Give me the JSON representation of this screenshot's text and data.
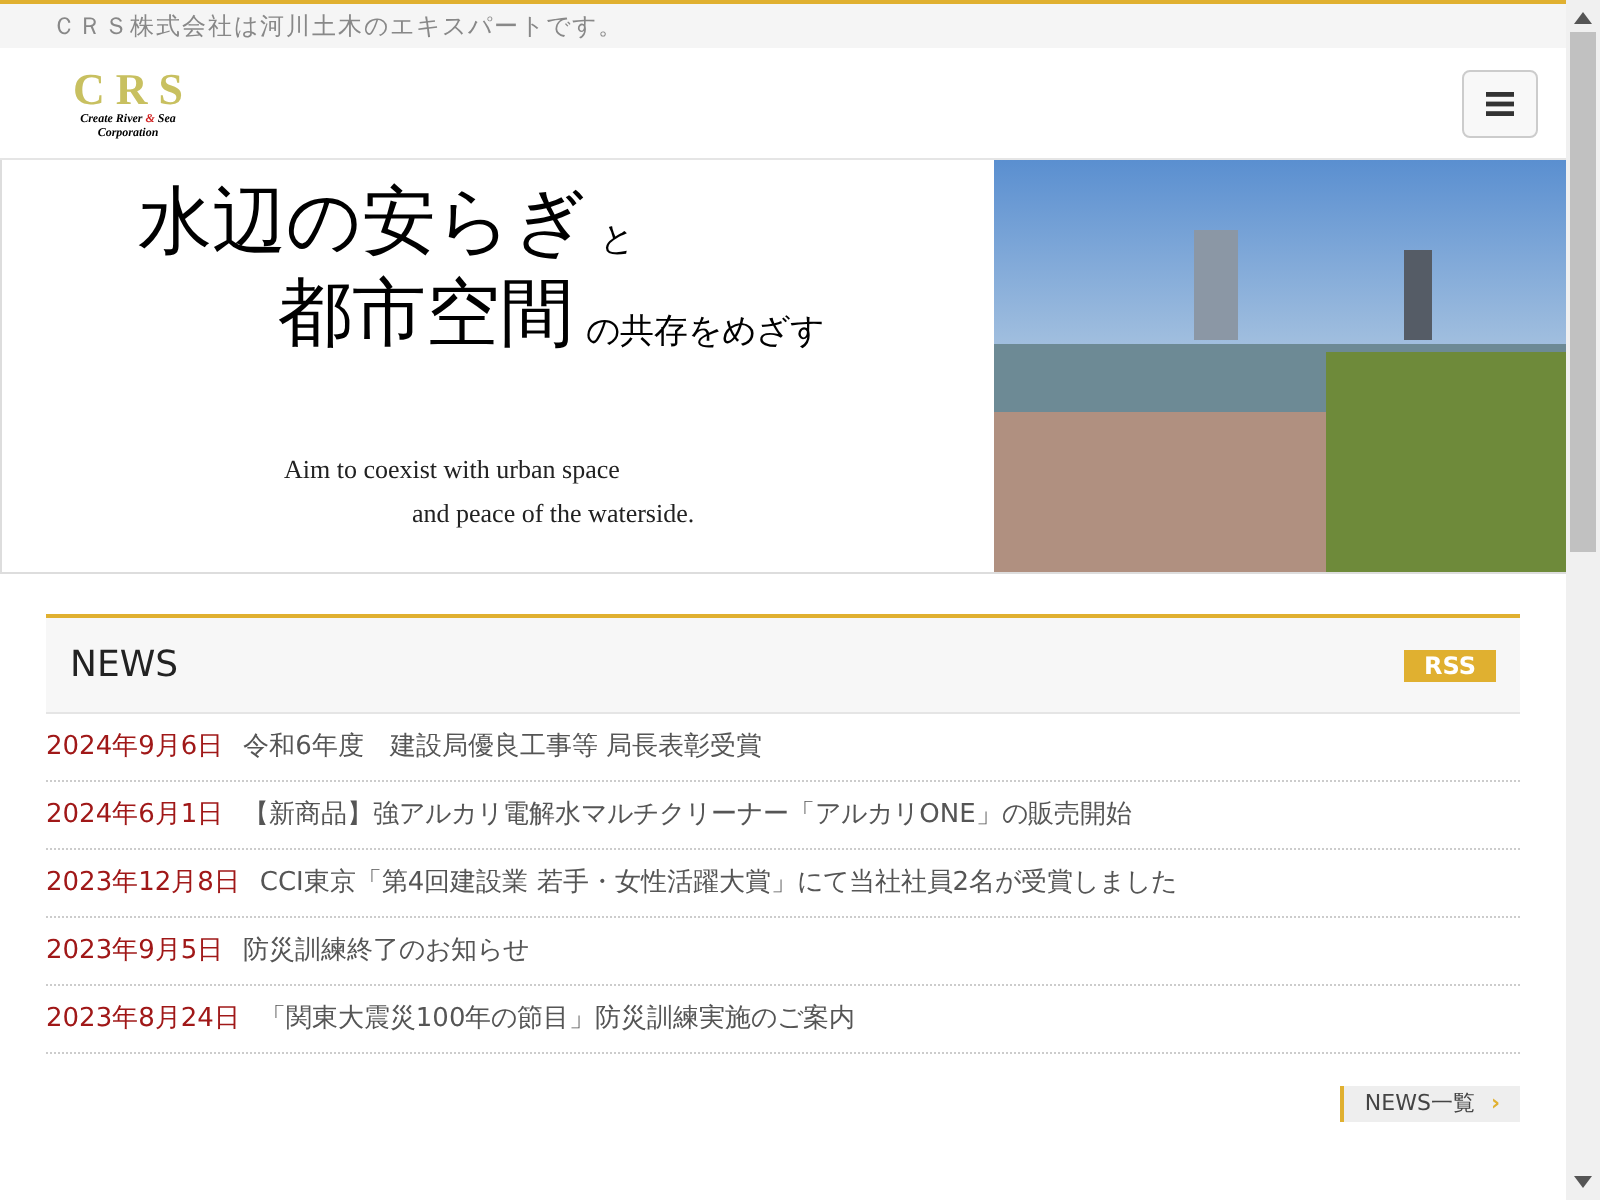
{
  "tagline": "ＣＲＳ株式会社は河川土木のエキスパートです。",
  "logo": {
    "letters": "C R S",
    "sub_before": "Create River",
    "sub_mark": "&",
    "sub_after": "Sea",
    "sub_line2": "Corporation"
  },
  "hero": {
    "lines": [
      {
        "large": "水辺の安らぎ",
        "small": "と"
      },
      {
        "large": "都市空間",
        "small": "の共存をめざす"
      }
    ],
    "english": [
      "Aim to coexist with urban space",
      "and peace of the waterside."
    ]
  },
  "news": {
    "title": "NEWS",
    "rss": "RSS",
    "items": [
      {
        "date": "2024年9月6日",
        "title": "令和6年度　建設局優良工事等 局長表彰受賞"
      },
      {
        "date": "2024年6月1日",
        "title": "【新商品】強アルカリ電解水マルチクリーナー「アルカリONE」の販売開始"
      },
      {
        "date": "2023年12月8日",
        "title": "CCI東京「第4回建設業 若手・女性活躍大賞」にて当社社員2名が受賞しました"
      },
      {
        "date": "2023年9月5日",
        "title": "防災訓練終了のお知らせ"
      },
      {
        "date": "2023年8月24日",
        "title": "「関東大震災100年の節目」防災訓練実施のご案内"
      }
    ],
    "more": "NEWS一覧",
    "more_arrow": "›"
  }
}
